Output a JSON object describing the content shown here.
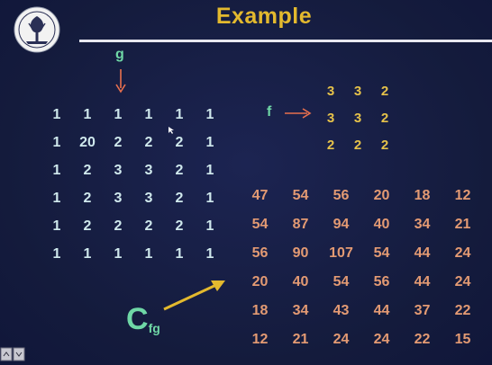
{
  "slide": {
    "title": "Example",
    "colors": {
      "background": "#141b3c",
      "title": "#e3b92e",
      "label": "#6fd7a6",
      "g_values": "#cfe8ec",
      "f_values": "#e6c24a",
      "c_values": "#e39a73",
      "arrows": "#e8704e",
      "c_arrow": "#e3b92e"
    },
    "logo_icon": "iit-kgp-emblem-icon"
  },
  "g": {
    "label": "g",
    "matrix": [
      [
        "1",
        "1",
        "1",
        "1",
        "1",
        "1"
      ],
      [
        "1",
        "20",
        "2",
        "2",
        "2",
        "1"
      ],
      [
        "1",
        "2",
        "3",
        "3",
        "2",
        "1"
      ],
      [
        "1",
        "2",
        "3",
        "3",
        "2",
        "1"
      ],
      [
        "1",
        "2",
        "2",
        "2",
        "2",
        "1"
      ],
      [
        "1",
        "1",
        "1",
        "1",
        "1",
        "1"
      ]
    ]
  },
  "f": {
    "label": "f",
    "matrix": [
      [
        "3",
        "3",
        "2"
      ],
      [
        "3",
        "3",
        "2"
      ],
      [
        "2",
        "2",
        "2"
      ]
    ]
  },
  "cfg": {
    "label_main": "C",
    "label_sub": "fg",
    "matrix": [
      [
        "47",
        "54",
        "56",
        "20",
        "18",
        "12"
      ],
      [
        "54",
        "87",
        "94",
        "40",
        "34",
        "21"
      ],
      [
        "56",
        "90",
        "107",
        "54",
        "44",
        "24"
      ],
      [
        "20",
        "40",
        "54",
        "56",
        "44",
        "24"
      ],
      [
        "18",
        "34",
        "43",
        "44",
        "37",
        "22"
      ],
      [
        "12",
        "21",
        "24",
        "24",
        "22",
        "15"
      ]
    ]
  }
}
